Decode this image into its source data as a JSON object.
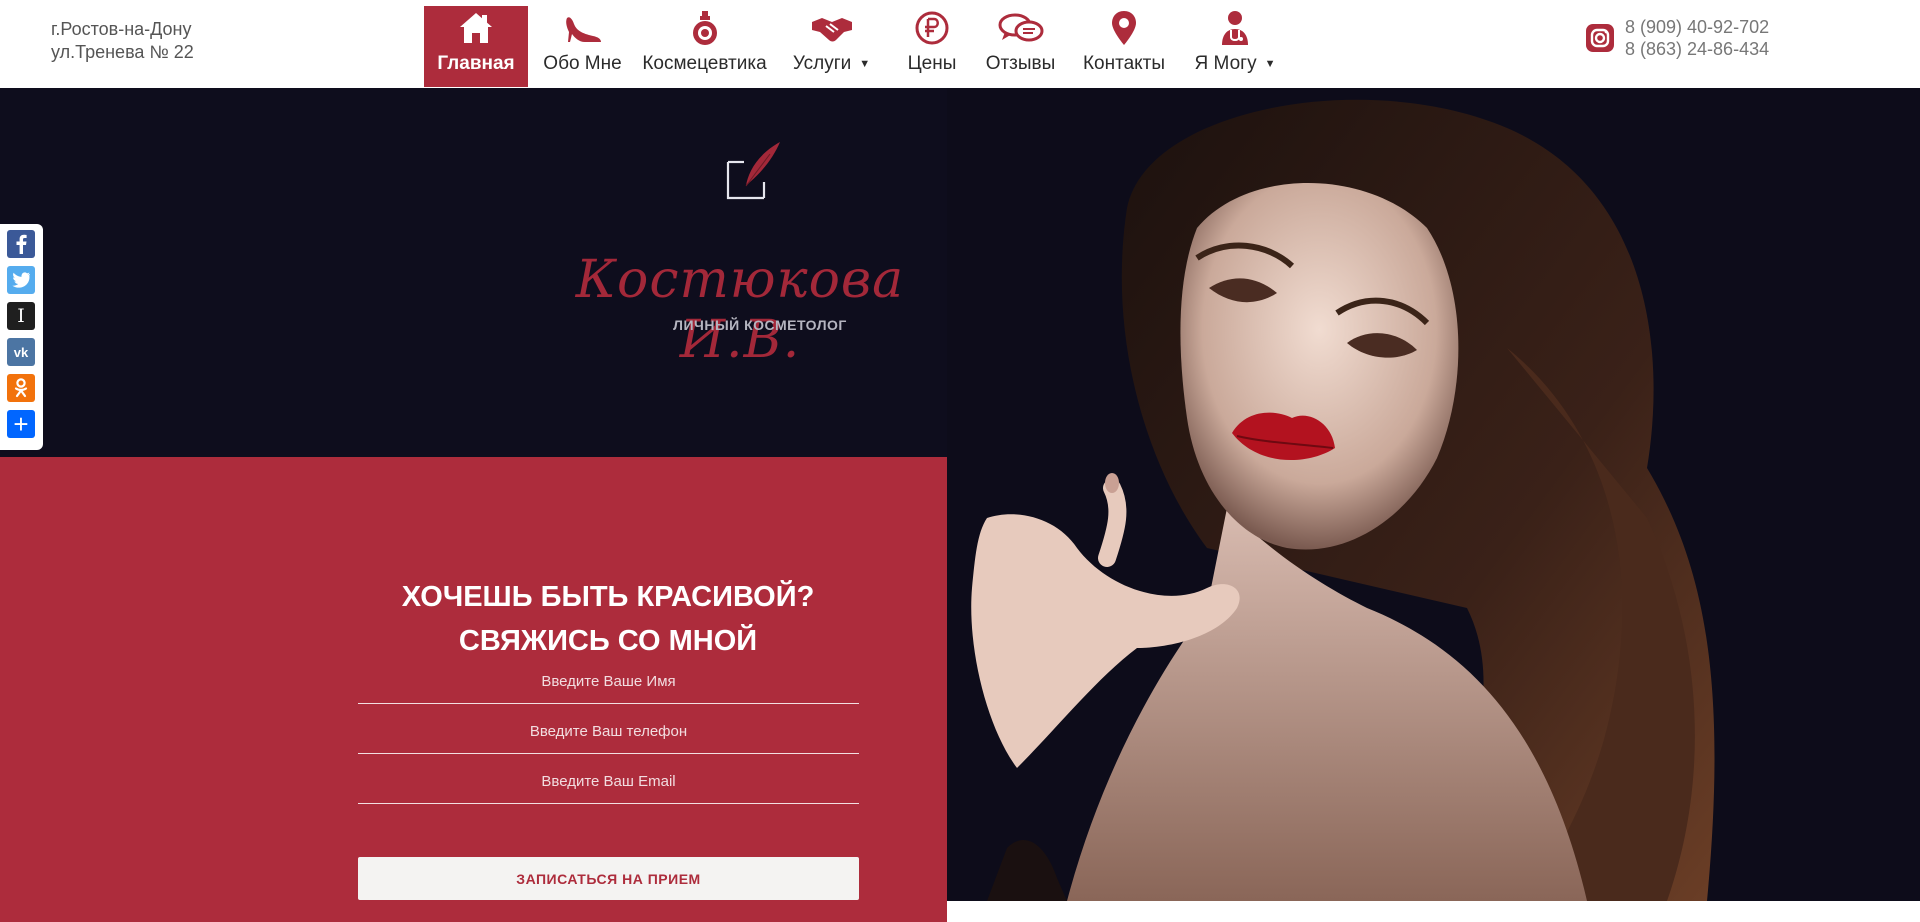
{
  "header": {
    "address_line1": "г.Ростов-на-Дону",
    "address_line2": "ул.Тренева № 22",
    "nav": [
      {
        "label": "Главная",
        "icon": "home-icon",
        "active": true
      },
      {
        "label": "Обо Мне",
        "icon": "high-heel-icon"
      },
      {
        "label": "Космецевтика",
        "icon": "perfume-bottle-icon"
      },
      {
        "label": "Услуги",
        "icon": "handshake-icon",
        "caret": "▼"
      },
      {
        "label": "Цены",
        "icon": "ruble-coin-icon"
      },
      {
        "label": "Отзывы",
        "icon": "speech-bubbles-icon"
      },
      {
        "label": "Контакты",
        "icon": "map-pin-icon"
      },
      {
        "label": "Я Могу",
        "icon": "doctor-icon",
        "caret": "▼"
      }
    ],
    "phone1": "8 (909) 40-92-702",
    "phone2": "8 (863) 24-86-434",
    "social_icon": "instagram-icon"
  },
  "hero": {
    "brand_name": "Костюкова И.В.",
    "brand_subtitle": "ЛИЧНЫЙ КОСМЕТОЛОГ",
    "logo_icon": "quill-frame-logo-icon",
    "photo_icon": "woman-portrait-photo"
  },
  "form": {
    "title_line1": "ХОЧЕШЬ БЫТЬ КРАСИВОЙ?",
    "title_line2": "СВЯЖИСЬ СО МНОЙ",
    "name_placeholder": "Введите Ваше Имя",
    "phone_placeholder": "Введите Ваш телефон",
    "email_placeholder": "Введите Ваш Email",
    "submit_label": "ЗАПИСАТЬСЯ НА ПРИЕМ"
  },
  "share": [
    {
      "name": "facebook-icon",
      "glyph": "f",
      "color": "#3b5998"
    },
    {
      "name": "twitter-icon",
      "glyph": "t",
      "color": "#55acee"
    },
    {
      "name": "instapaper-icon",
      "glyph": "I",
      "color": "#1f1f1f"
    },
    {
      "name": "vk-icon",
      "glyph": "vk",
      "color": "#4c75a3"
    },
    {
      "name": "odnoklassniki-icon",
      "glyph": "ok",
      "color": "#f2720c"
    },
    {
      "name": "share-more-icon",
      "glyph": "+",
      "color": "#0166ff"
    }
  ],
  "colors": {
    "accent": "#ad2c3c",
    "hero_bg": "#0e0d1d",
    "nav_text": "#2b2b2b"
  }
}
